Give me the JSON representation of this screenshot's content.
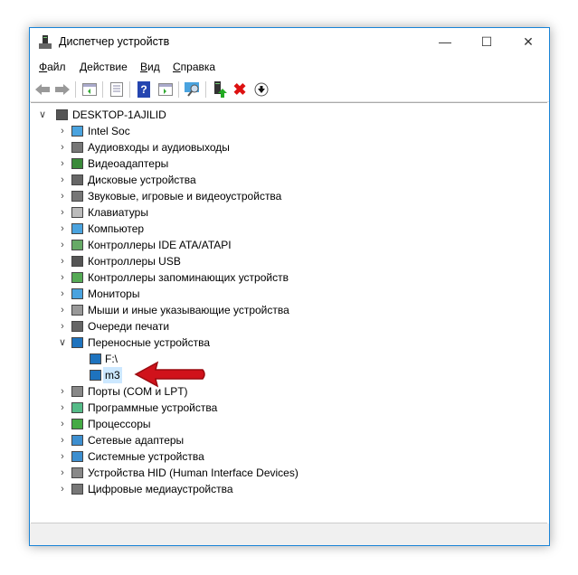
{
  "window": {
    "title": "Диспетчер устройств",
    "minimize": "—",
    "maximize": "☐",
    "close": "✕"
  },
  "menu": [
    {
      "label": "Файл",
      "key": "Ф",
      "rest": "айл"
    },
    {
      "label": "Действие",
      "key": "Д",
      "rest": "ействие"
    },
    {
      "label": "Вид",
      "key": "В",
      "rest": "ид"
    },
    {
      "label": "Справка",
      "key": "С",
      "rest": "правка"
    }
  ],
  "toolbar": {
    "help": "?"
  },
  "tree": {
    "root": "DESKTOP-1AJILID",
    "categories": [
      {
        "label": "Intel Soc",
        "icon": "monitor-icon"
      },
      {
        "label": "Аудиовходы и аудиовыходы",
        "icon": "speaker-icon"
      },
      {
        "label": "Видеоадаптеры",
        "icon": "display-adapter-icon"
      },
      {
        "label": "Дисковые устройства",
        "icon": "disk-icon"
      },
      {
        "label": "Звуковые, игровые и видеоустройства",
        "icon": "speaker-icon"
      },
      {
        "label": "Клавиатуры",
        "icon": "keyboard-icon"
      },
      {
        "label": "Компьютер",
        "icon": "monitor-icon"
      },
      {
        "label": "Контроллеры IDE ATA/ATAPI",
        "icon": "controller-icon"
      },
      {
        "label": "Контроллеры USB",
        "icon": "usb-icon"
      },
      {
        "label": "Контроллеры запоминающих устройств",
        "icon": "storage-controller-icon"
      },
      {
        "label": "Мониторы",
        "icon": "monitor-icon"
      },
      {
        "label": "Мыши и иные указывающие устройства",
        "icon": "mouse-icon"
      },
      {
        "label": "Очереди печати",
        "icon": "printer-icon"
      },
      {
        "label": "Переносные устройства",
        "icon": "portable-device-icon",
        "expanded": true,
        "children": [
          {
            "label": "F:\\"
          },
          {
            "label": "m3",
            "selected": true
          }
        ]
      },
      {
        "label": "Порты (COM и LPT)",
        "icon": "port-icon"
      },
      {
        "label": "Программные устройства",
        "icon": "software-device-icon"
      },
      {
        "label": "Процессоры",
        "icon": "cpu-icon"
      },
      {
        "label": "Сетевые адаптеры",
        "icon": "network-icon"
      },
      {
        "label": "Системные устройства",
        "icon": "system-icon"
      },
      {
        "label": "Устройства HID (Human Interface Devices)",
        "icon": "hid-icon"
      },
      {
        "label": "Цифровые медиаустройства",
        "icon": "media-icon"
      }
    ]
  },
  "colors": {
    "accent": "#1883d7",
    "selection": "#cce8ff",
    "arrow": "#d0121b"
  }
}
